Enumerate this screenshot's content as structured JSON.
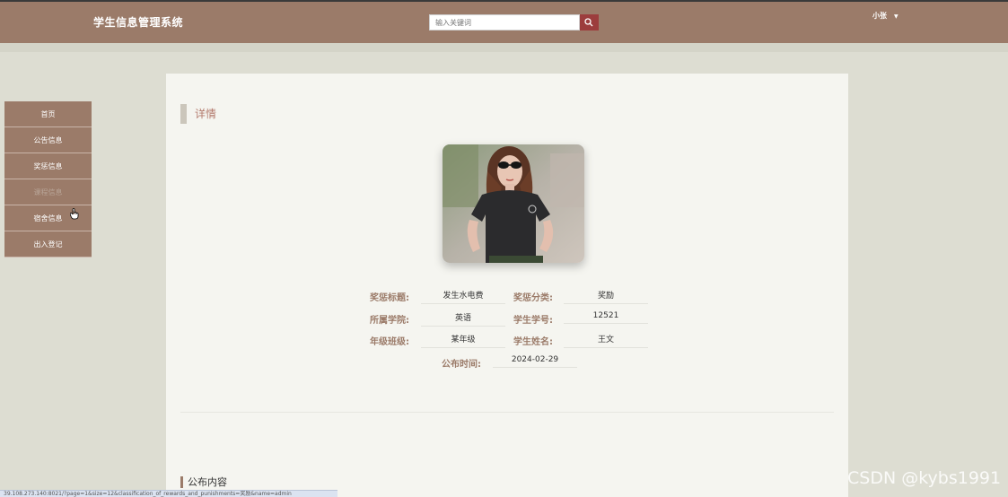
{
  "header": {
    "title": "学生信息管理系统",
    "search_placeholder": "输入关键词",
    "user": "小张"
  },
  "sidebar": {
    "items": [
      {
        "label": "首页"
      },
      {
        "label": "公告信息"
      },
      {
        "label": "奖惩信息"
      },
      {
        "label": "课程信息"
      },
      {
        "label": "宿舍信息"
      },
      {
        "label": "出入登记"
      }
    ]
  },
  "detail": {
    "section_title": "详情",
    "fields": {
      "title_label": "奖惩标题:",
      "title_value": "发生水电费",
      "category_label": "奖惩分类:",
      "category_value": "奖励",
      "college_label": "所属学院:",
      "college_value": "英语",
      "student_no_label": "学生学号:",
      "student_no_value": "12521",
      "grade_label": "年级班级:",
      "grade_value": "某年级",
      "student_name_label": "学生姓名:",
      "student_name_value": "王文",
      "publish_time_label": "公布时间:",
      "publish_time_value": "2024-02-29"
    },
    "content_title": "公布内容"
  },
  "watermark": "CSDN @kybs1991",
  "status_url": "39.108.273.140:8021/?page=1&size=12&classification_of_rewards_and_punishments=奖励&name=admin",
  "colors": {
    "header_bg": "#9b7b69",
    "accent": "#9c3d3d",
    "page_bg": "#ddddd2",
    "panel_bg": "#f5f5f0"
  }
}
